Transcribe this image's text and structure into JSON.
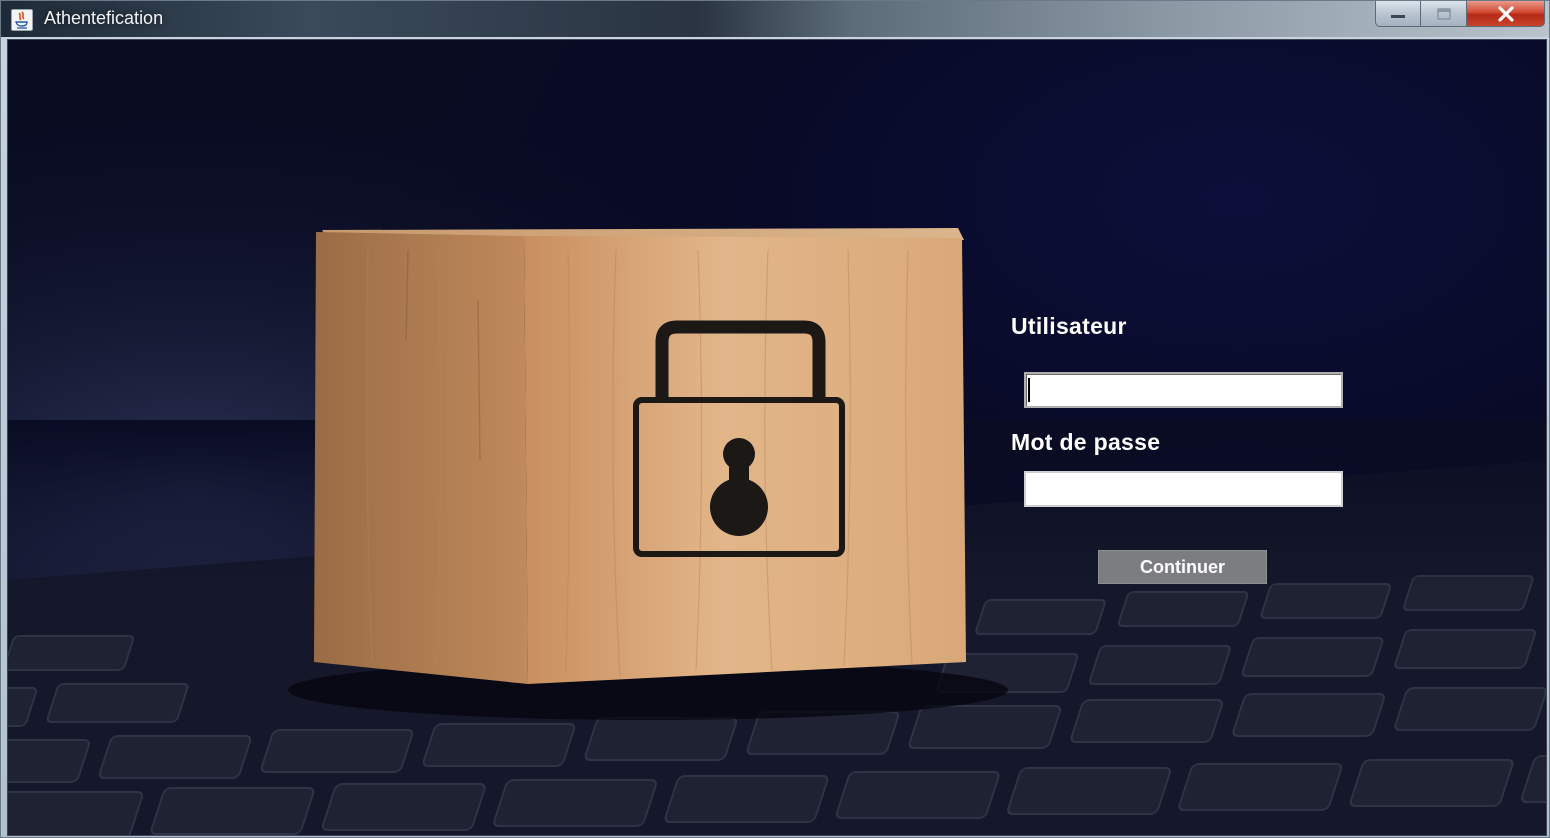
{
  "window": {
    "title": "Athentefication",
    "controls": [
      "minimize",
      "maximize",
      "close"
    ]
  },
  "form": {
    "username_label": "Utilisateur",
    "username_value": "",
    "password_label": "Mot de passe",
    "password_value": "",
    "submit_label": "Continuer"
  },
  "background": {
    "subject": "wooden cube with padlock icon on keyboard"
  },
  "colors": {
    "background_dark": "#080a26",
    "wood": "#d5a675",
    "button": "#7b7d80",
    "label_text": "#ffffff"
  }
}
